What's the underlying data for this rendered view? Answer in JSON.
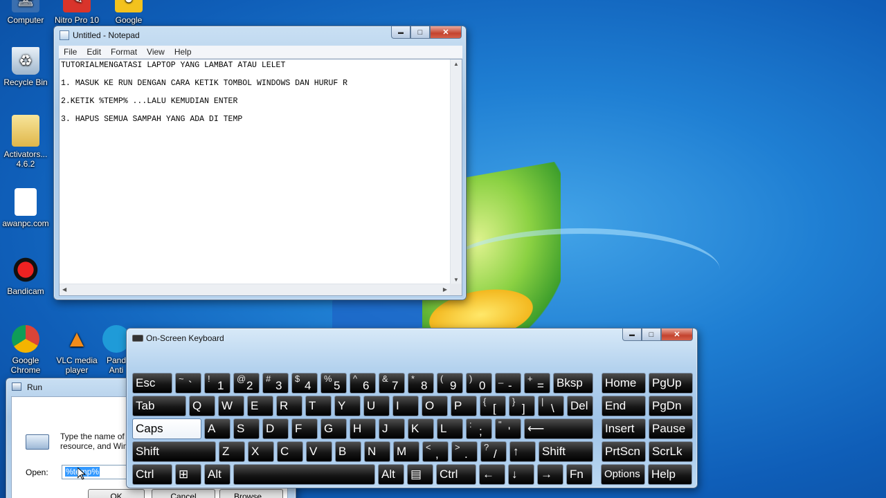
{
  "desktop": {
    "icons": [
      {
        "label": "Computer",
        "name": "computer-icon"
      },
      {
        "label": "Nitro Pro 10",
        "name": "nitro-pro-icon"
      },
      {
        "label": "Google",
        "name": "google-icon"
      },
      {
        "label": "Recycle Bin",
        "name": "recycle-bin-icon"
      },
      {
        "label": "Activators... 4.6.2",
        "name": "folder-icon"
      },
      {
        "label": "awanpc.com",
        "name": "document-shortcut-icon"
      },
      {
        "label": "Bandicam",
        "name": "bandicam-icon"
      },
      {
        "label": "Google Chrome",
        "name": "chrome-icon"
      },
      {
        "label": "VLC media player",
        "name": "vlc-icon"
      },
      {
        "label": "Pand Anti",
        "name": "panda-antivirus-icon"
      }
    ]
  },
  "notepad": {
    "title": "Untitled - Notepad",
    "menu": [
      "File",
      "Edit",
      "Format",
      "View",
      "Help"
    ],
    "lines": [
      "TUTORIALMENGATASI LAPTOP YANG LAMBAT ATAU LELET",
      "1. MASUK KE RUN DENGAN CARA KETIK TOMBOL WINDOWS DAN HURUF R",
      "2.KETIK %TEMP% ...LALU KEMUDIAN ENTER",
      "3. HAPUS SEMUA SAMPAH YANG ADA DI TEMP"
    ]
  },
  "osk": {
    "title": "On-Screen Keyboard",
    "rows": [
      [
        {
          "main": "Esc",
          "w": 58
        },
        {
          "shift": "~",
          "main": "`",
          "w": 38
        },
        {
          "shift": "!",
          "main": "1",
          "w": 38
        },
        {
          "shift": "@",
          "main": "2",
          "w": 38
        },
        {
          "shift": "#",
          "main": "3",
          "w": 38
        },
        {
          "shift": "$",
          "main": "4",
          "w": 38
        },
        {
          "shift": "%",
          "main": "5",
          "w": 38
        },
        {
          "shift": "^",
          "main": "6",
          "w": 38
        },
        {
          "shift": "&",
          "main": "7",
          "w": 38
        },
        {
          "shift": "*",
          "main": "8",
          "w": 38
        },
        {
          "shift": "(",
          "main": "9",
          "w": 38
        },
        {
          "shift": ")",
          "main": "0",
          "w": 38
        },
        {
          "shift": "_",
          "main": "-",
          "w": 38
        },
        {
          "shift": "+",
          "main": "=",
          "w": 38
        },
        {
          "main": "Bksp",
          "w": 58
        },
        {
          "main": "Home",
          "w": 64,
          "gap": 8
        },
        {
          "main": "PgUp",
          "w": 64
        }
      ],
      [
        {
          "main": "Tab",
          "w": 78
        },
        {
          "main": "Q",
          "w": 38
        },
        {
          "main": "W",
          "w": 38
        },
        {
          "main": "E",
          "w": 38
        },
        {
          "main": "R",
          "w": 38
        },
        {
          "main": "T",
          "w": 38
        },
        {
          "main": "Y",
          "w": 38
        },
        {
          "main": "U",
          "w": 38
        },
        {
          "main": "I",
          "w": 38
        },
        {
          "main": "O",
          "w": 38
        },
        {
          "main": "P",
          "w": 38
        },
        {
          "shift": "{",
          "main": "[",
          "w": 38
        },
        {
          "shift": "}",
          "main": "]",
          "w": 38
        },
        {
          "shift": "|",
          "main": "\\",
          "w": 38
        },
        {
          "main": "Del",
          "w": 38
        },
        {
          "main": "End",
          "w": 64,
          "gap": 8
        },
        {
          "main": "PgDn",
          "w": 64
        }
      ],
      [
        {
          "main": "Caps",
          "w": 100,
          "lit": true
        },
        {
          "main": "A",
          "w": 38
        },
        {
          "main": "S",
          "w": 38
        },
        {
          "main": "D",
          "w": 38
        },
        {
          "main": "F",
          "w": 38
        },
        {
          "main": "G",
          "w": 38
        },
        {
          "main": "H",
          "w": 38
        },
        {
          "main": "J",
          "w": 38
        },
        {
          "main": "K",
          "w": 38
        },
        {
          "main": "L",
          "w": 38
        },
        {
          "shift": ":",
          "main": ";",
          "w": 38
        },
        {
          "shift": "\"",
          "main": "'",
          "w": 38
        },
        {
          "main": "⟵",
          "w": 100
        },
        {
          "main": "Insert",
          "w": 64,
          "gap": 8
        },
        {
          "main": "Pause",
          "w": 64
        }
      ],
      [
        {
          "main": "Shift",
          "w": 121
        },
        {
          "main": "Z",
          "w": 38
        },
        {
          "main": "X",
          "w": 38
        },
        {
          "main": "C",
          "w": 38
        },
        {
          "main": "V",
          "w": 38
        },
        {
          "main": "B",
          "w": 38
        },
        {
          "main": "N",
          "w": 38
        },
        {
          "main": "M",
          "w": 38
        },
        {
          "shift": "<",
          "main": ",",
          "w": 38
        },
        {
          "shift": ">",
          "main": ".",
          "w": 38
        },
        {
          "shift": "?",
          "main": "/",
          "w": 38
        },
        {
          "main": "↑",
          "w": 38
        },
        {
          "main": "Shift",
          "w": 79
        },
        {
          "main": "PrtScn",
          "w": 64,
          "gap": 8
        },
        {
          "main": "ScrLk",
          "w": 64
        }
      ],
      [
        {
          "main": "Ctrl",
          "w": 58
        },
        {
          "main": "⊞",
          "w": 38
        },
        {
          "main": "Alt",
          "w": 38
        },
        {
          "main": "",
          "w": 205
        },
        {
          "main": "Alt",
          "w": 38
        },
        {
          "main": "▤",
          "w": 38
        },
        {
          "main": "Ctrl",
          "w": 58
        },
        {
          "main": "←",
          "w": 38
        },
        {
          "main": "↓",
          "w": 38
        },
        {
          "main": "→",
          "w": 38
        },
        {
          "main": "Fn",
          "w": 38
        },
        {
          "main": "Options",
          "w": 64,
          "gap": 8,
          "small": true
        },
        {
          "main": "Help",
          "w": 64
        }
      ]
    ]
  },
  "run": {
    "title": "Run",
    "desc_line1": "Type the name of a",
    "desc_line2": "resource, and Wind",
    "open_label": "Open:",
    "open_value": "%temp%",
    "ok": "OK",
    "cancel": "Cancel",
    "browse": "Browse..."
  },
  "window_buttons": {
    "minimize": "▬",
    "maximize": "□",
    "close": "✕"
  }
}
